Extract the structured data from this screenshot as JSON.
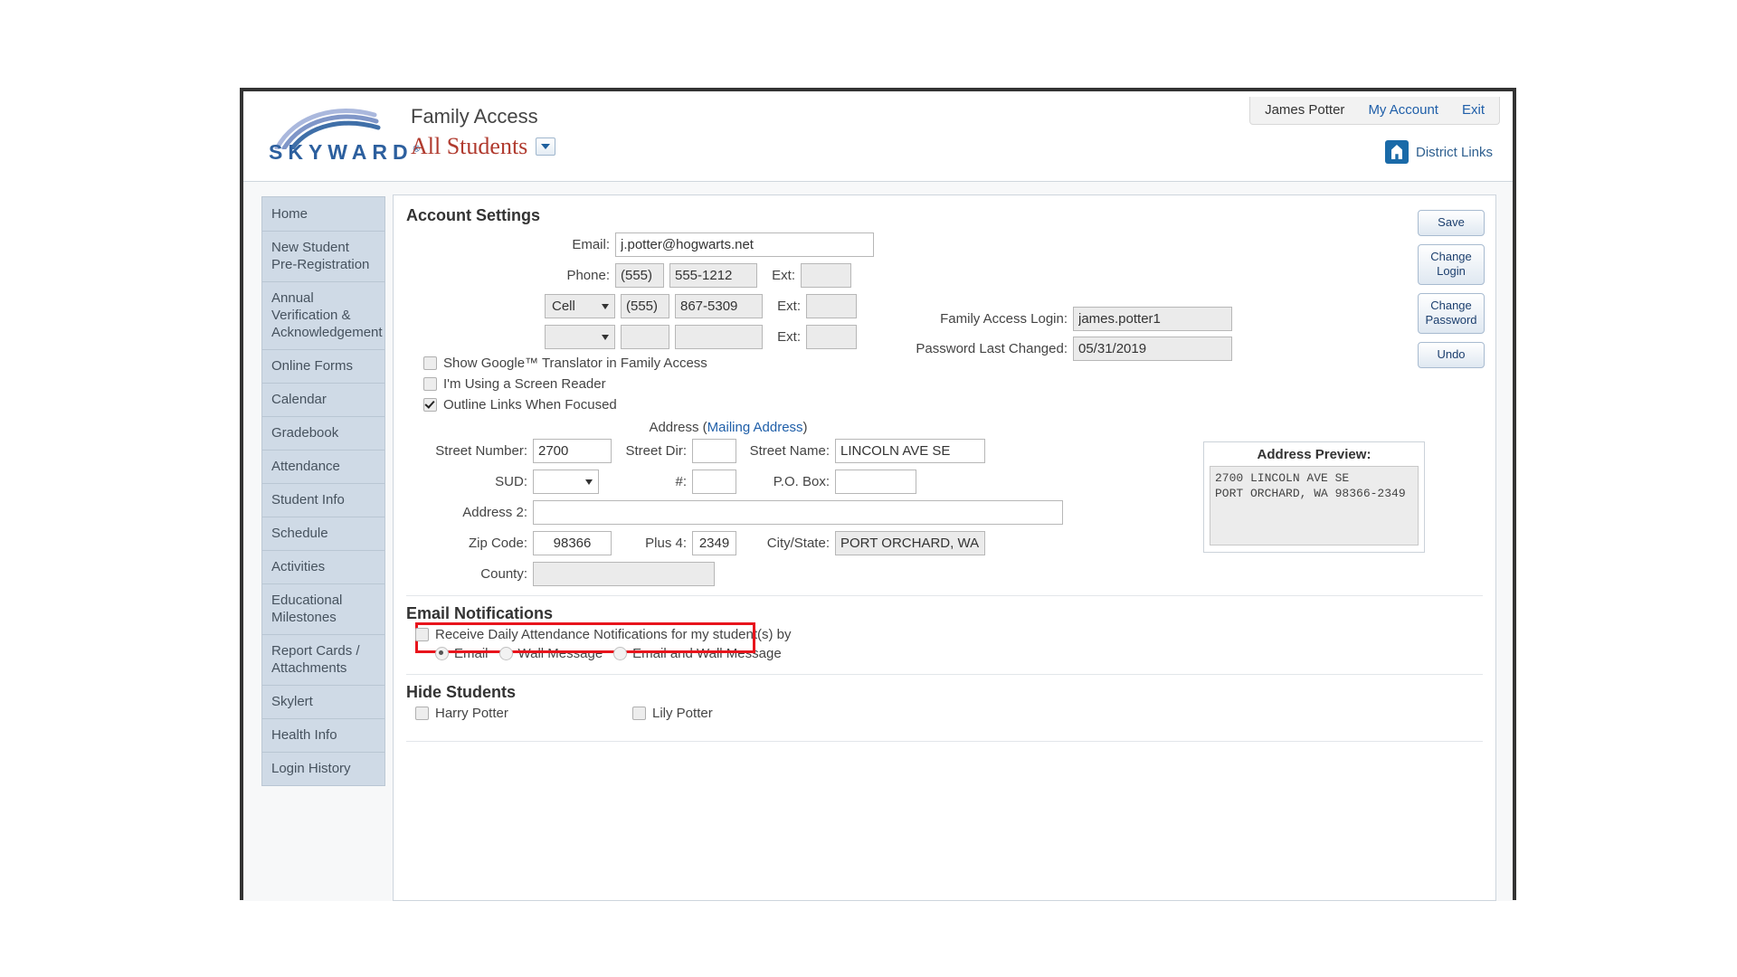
{
  "header": {
    "logo_text": "SKYWARD",
    "logo_sup": "®",
    "app_title": "Family Access",
    "student_selector": "All Students",
    "user_name": "James Potter",
    "my_account": "My Account",
    "exit": "Exit",
    "district_links": "District Links"
  },
  "sidebar": {
    "items": [
      {
        "label": "Home"
      },
      {
        "label": "New Student Pre-Registration"
      },
      {
        "label": "Annual Verification & Acknowledgement"
      },
      {
        "label": "Online Forms"
      },
      {
        "label": "Calendar"
      },
      {
        "label": "Gradebook"
      },
      {
        "label": "Attendance"
      },
      {
        "label": "Student Info"
      },
      {
        "label": "Schedule"
      },
      {
        "label": "Activities"
      },
      {
        "label": "Educational Milestones"
      },
      {
        "label": "Report Cards / Attachments"
      },
      {
        "label": "Skylert"
      },
      {
        "label": "Health Info"
      },
      {
        "label": "Login History"
      }
    ]
  },
  "main": {
    "section_title": "Account Settings",
    "buttons": {
      "save": "Save",
      "change_login": "Change Login",
      "change_password": "Change Password",
      "undo": "Undo"
    },
    "account": {
      "email_label": "Email:",
      "email_value": "j.potter@hogwarts.net",
      "phone_label": "Phone:",
      "phone_area": "(555)",
      "phone_number": "555-1212",
      "ext_label": "Ext:",
      "phone_ext": "",
      "phone2_type": "Cell",
      "phone2_area": "(555)",
      "phone2_number": "867-5309",
      "phone2_ext": "",
      "phone3_type": "",
      "phone3_area": "",
      "phone3_number": "",
      "phone3_ext": "",
      "login_label": "Family Access Login:",
      "login_value": "james.potter1",
      "password_changed_label": "Password Last Changed:",
      "password_changed_value": "05/31/2019"
    },
    "options": [
      {
        "label": "Show Google™ Translator in Family Access",
        "checked": false
      },
      {
        "label": "I'm Using a Screen Reader",
        "checked": false
      },
      {
        "label": "Outline Links When Focused",
        "checked": true
      }
    ],
    "address": {
      "heading": "Address (",
      "heading_link": "Mailing Address",
      "heading_close": ")",
      "street_number_label": "Street Number:",
      "street_number": "2700",
      "street_dir_label": "Street Dir:",
      "street_dir": "",
      "street_name_label": "Street Name:",
      "street_name": "LINCOLN AVE SE",
      "sud_label": "SUD:",
      "sud": "",
      "unit_label": "#:",
      "unit": "",
      "po_box_label": "P.O. Box:",
      "po_box": "",
      "address2_label": "Address 2:",
      "address2": "",
      "zip_label": "Zip Code:",
      "zip": "98366",
      "plus4_label": "Plus 4:",
      "plus4": "2349",
      "city_state_label": "City/State:",
      "city_state": "PORT ORCHARD, WA",
      "county_label": "County:",
      "county": "",
      "preview_title": "Address Preview:",
      "preview_text": "2700 LINCOLN AVE SE\nPORT ORCHARD, WA 98366-2349"
    },
    "email_notifications": {
      "title": "Email Notifications",
      "checkbox_label": "Receive Daily Attendance Notifications for my student(s) by",
      "checkbox_checked": false,
      "radios": [
        {
          "label": "Email",
          "selected": true
        },
        {
          "label": "Wall Message",
          "selected": false
        },
        {
          "label": "Email and Wall Message",
          "selected": false
        }
      ],
      "highlight_color": "#e8141c"
    },
    "hide_students": {
      "title": "Hide Students",
      "students": [
        {
          "label": "Harry Potter",
          "checked": false
        },
        {
          "label": "Lily Potter",
          "checked": false
        }
      ]
    }
  }
}
